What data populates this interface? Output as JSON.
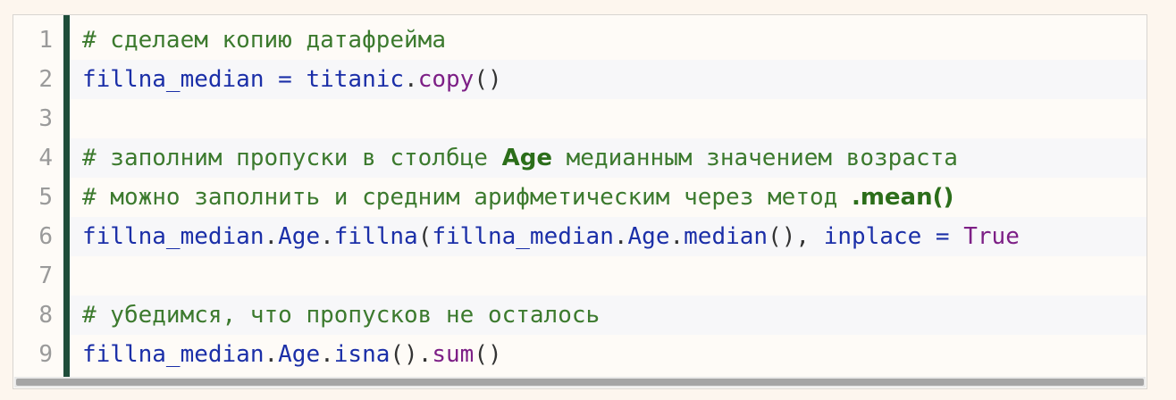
{
  "colors": {
    "comment": "#3c7a2e",
    "identifier": "#1b2fa8",
    "method": "#7d1f86",
    "gutter_bar": "#1e4d3a",
    "line_number": "#9a9a9a"
  },
  "lines": [
    {
      "number": "1",
      "tokens": [
        {
          "type": "comment",
          "text": "# сделаем копию датафрейма"
        }
      ]
    },
    {
      "number": "2",
      "tokens": [
        {
          "type": "name",
          "text": "fillna_median"
        },
        {
          "type": "op",
          "text": " = "
        },
        {
          "type": "name",
          "text": "titanic"
        },
        {
          "type": "punct",
          "text": "."
        },
        {
          "type": "method",
          "text": "copy"
        },
        {
          "type": "punct",
          "text": "()"
        }
      ]
    },
    {
      "number": "3",
      "tokens": []
    },
    {
      "number": "4",
      "tokens": [
        {
          "type": "comment",
          "text": "# заполним пропуски в столбце "
        },
        {
          "type": "hl",
          "text": "Age"
        },
        {
          "type": "comment",
          "text": " медианным значением возраста"
        }
      ]
    },
    {
      "number": "5",
      "tokens": [
        {
          "type": "comment",
          "text": "# можно заполнить и средним арифметическим через метод "
        },
        {
          "type": "hl",
          "text": ".mean()"
        }
      ]
    },
    {
      "number": "6",
      "tokens": [
        {
          "type": "name",
          "text": "fillna_median"
        },
        {
          "type": "punct",
          "text": "."
        },
        {
          "type": "name",
          "text": "Age"
        },
        {
          "type": "punct",
          "text": "."
        },
        {
          "type": "name",
          "text": "fillna"
        },
        {
          "type": "punct",
          "text": "("
        },
        {
          "type": "name",
          "text": "fillna_median"
        },
        {
          "type": "punct",
          "text": "."
        },
        {
          "type": "name",
          "text": "Age"
        },
        {
          "type": "punct",
          "text": "."
        },
        {
          "type": "name",
          "text": "median"
        },
        {
          "type": "punct",
          "text": "(), "
        },
        {
          "type": "name",
          "text": "inplace"
        },
        {
          "type": "op",
          "text": " = "
        },
        {
          "type": "kw",
          "text": "True"
        }
      ]
    },
    {
      "number": "7",
      "tokens": []
    },
    {
      "number": "8",
      "tokens": [
        {
          "type": "comment",
          "text": "# убедимся, что пропусков не осталось"
        }
      ]
    },
    {
      "number": "9",
      "tokens": [
        {
          "type": "name",
          "text": "fillna_median"
        },
        {
          "type": "punct",
          "text": "."
        },
        {
          "type": "name",
          "text": "Age"
        },
        {
          "type": "punct",
          "text": "."
        },
        {
          "type": "name",
          "text": "isna"
        },
        {
          "type": "punct",
          "text": "()."
        },
        {
          "type": "method",
          "text": "sum"
        },
        {
          "type": "punct",
          "text": "()"
        }
      ]
    }
  ]
}
